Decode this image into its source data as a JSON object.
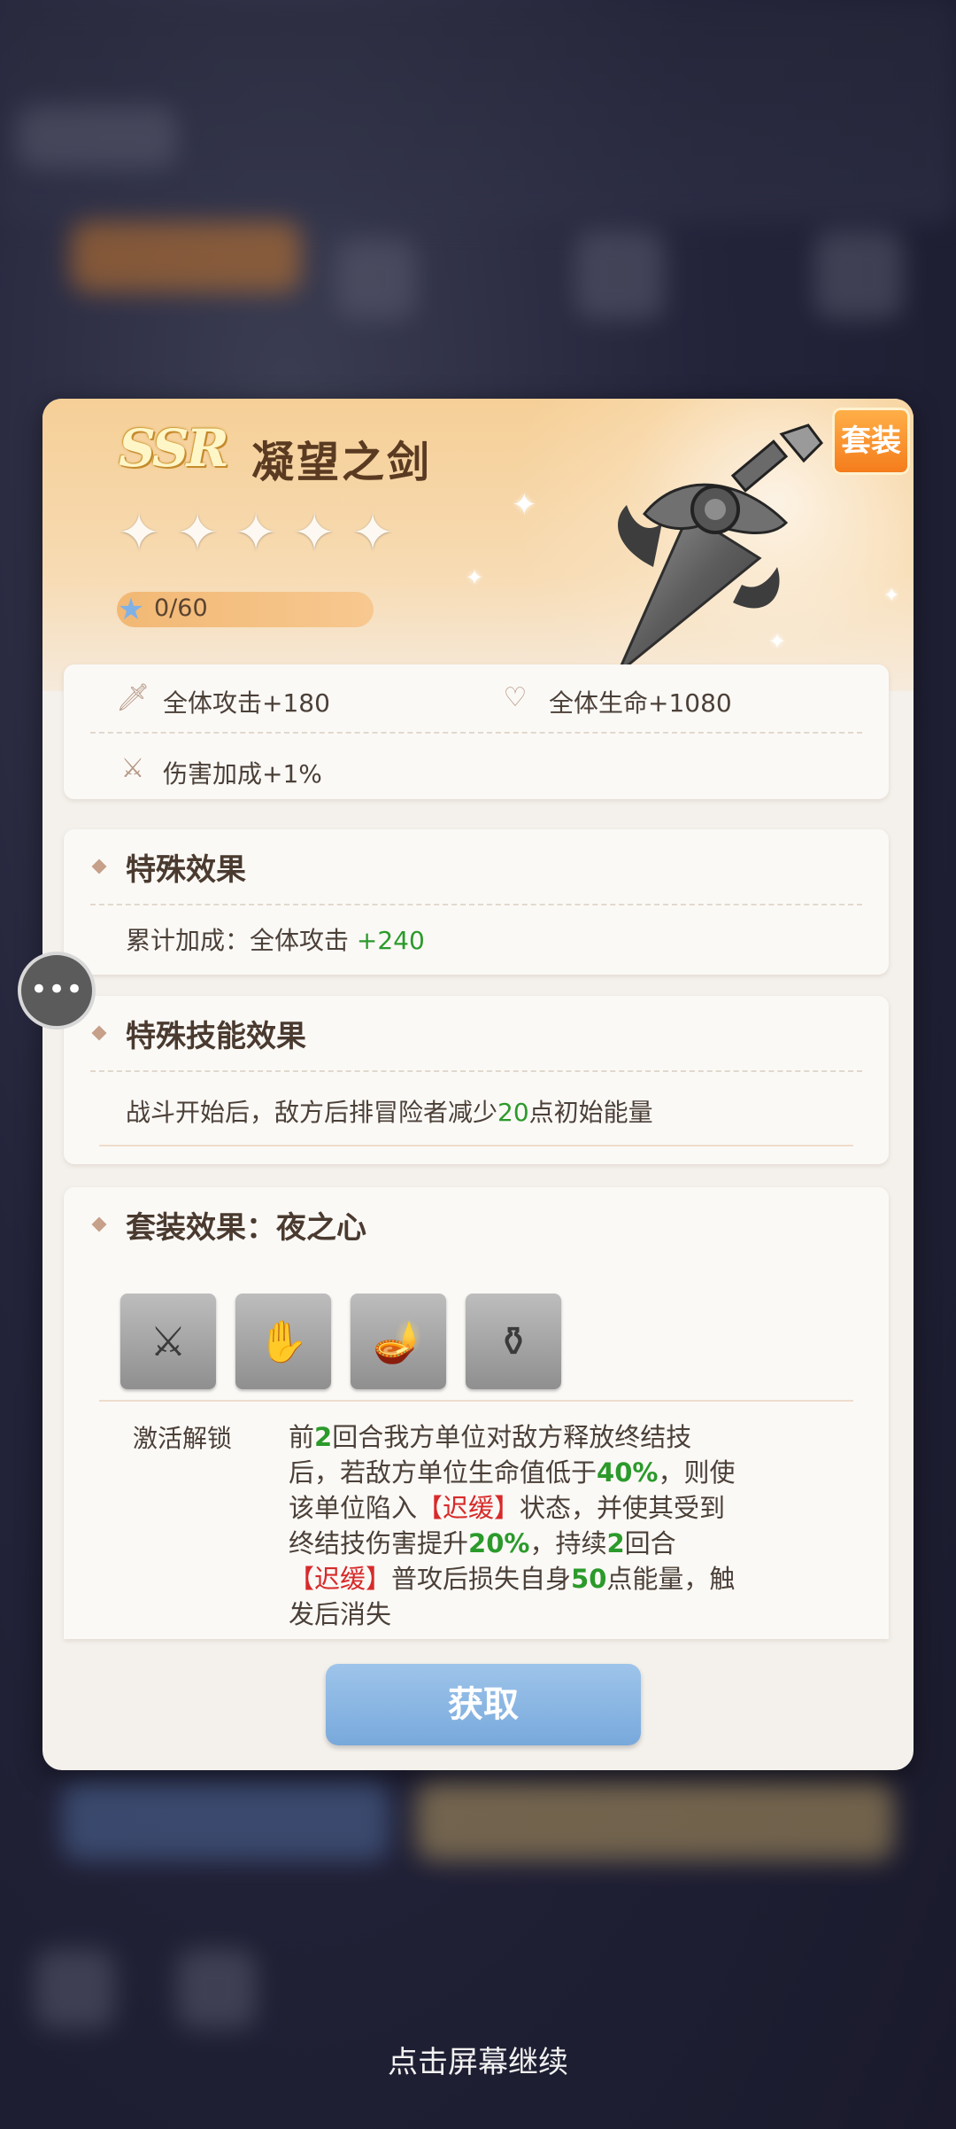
{
  "item": {
    "rarity": "SSR",
    "name": "凝望之剑",
    "stars_filled": 0,
    "stars_total": 5,
    "progress_text": "0/60",
    "set_tag": "套装"
  },
  "stats": {
    "atk": "全体攻击+180",
    "hp": "全体生命+1080",
    "dmg": "伤害加成+1%"
  },
  "special_effect": {
    "title": "特殊效果",
    "prefix": "累计加成：全体攻击 ",
    "value": "+240"
  },
  "special_skill": {
    "title": "特殊技能效果",
    "text_before": "战斗开始后，敌方后排冒险者减少",
    "value": "20",
    "text_after": "点初始能量"
  },
  "set_effect": {
    "title": "套装效果：夜之心",
    "thumbnails": [
      "sword-icon",
      "gauntlet-icon",
      "lamp-icon",
      "vase-icon"
    ],
    "unlock_label": "激活解锁",
    "line1_a": "前",
    "line1_b": "2",
    "line1_c": "回合我方单位对敌方释放终结技",
    "line2_a": "后，若敌方单位生命值低于",
    "line2_b": "40%",
    "line2_c": "，则使",
    "line3_a": "该单位陷入",
    "line3_b": "【迟缓】",
    "line3_c": "状态，并使其受到",
    "line4_a": "终结技伤害提升",
    "line4_b": "20%",
    "line4_c": "，持续",
    "line4_d": "2",
    "line4_e": "回合",
    "line5_a": "【迟缓】",
    "line5_b": "普攻后损失自身",
    "line5_c": "50",
    "line5_d": "点能量，触",
    "line6": "发后消失"
  },
  "button": {
    "get": "获取"
  },
  "footer": {
    "continue": "点击屏幕继续"
  },
  "colors": {
    "header_gold": "#f6cf97",
    "green_value": "#2b9a2b",
    "red_keyword": "#d72a2a",
    "button_blue": "#78a9dc"
  }
}
